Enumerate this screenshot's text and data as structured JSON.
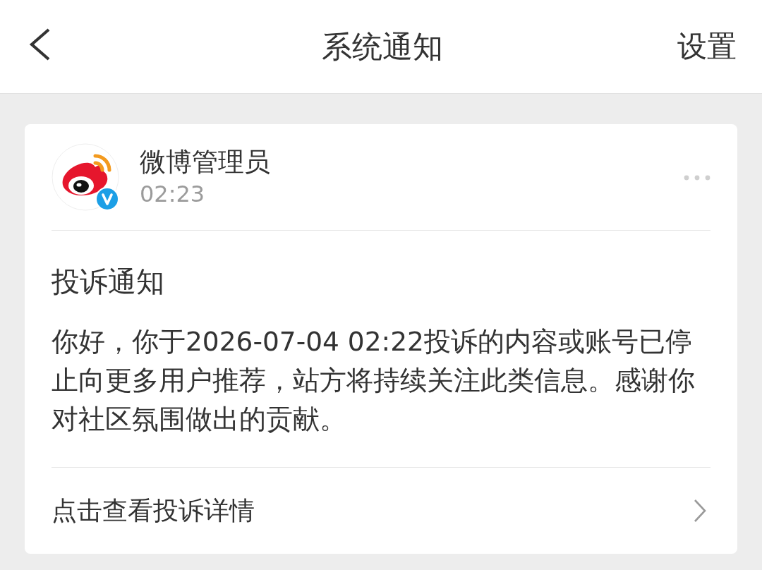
{
  "header": {
    "title": "系统通知",
    "action": "设置"
  },
  "message": {
    "sender": "微博管理员",
    "time": "02:23",
    "verified": true,
    "title": "投诉通知",
    "body": "你好，你于2026-07-04 02:22投诉的内容或账号已停止向更多用户推荐，站方将持续关注此类信息。感谢你对社区氛围做出的贡献。",
    "link": "点击查看投诉详情"
  }
}
